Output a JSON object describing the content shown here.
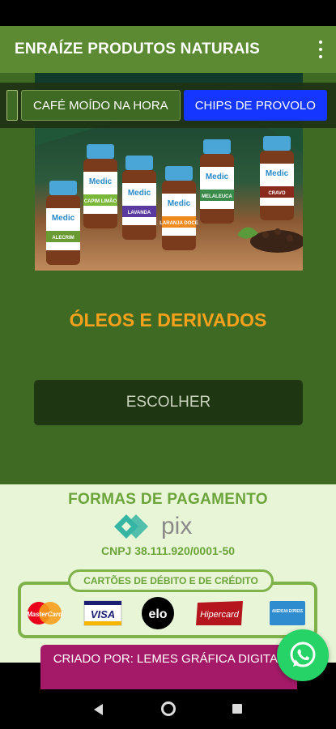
{
  "app": {
    "title": "ENRAÍZE PRODUTOS NATURAIS"
  },
  "tabs": [
    {
      "label": "CAFÉ MOÍDO NA HORA",
      "active": false
    },
    {
      "label": "CHIPS DE PROVOLO",
      "active": true
    }
  ],
  "banner": {
    "brand": "Medic",
    "products": [
      "ALECRIM",
      "CAPIM LIMÃO",
      "LAVANDA",
      "LARANJA DOCE",
      "MELALEUCA",
      "CRAVO"
    ]
  },
  "section": {
    "title": "ÓLEOS E DERIVADOS",
    "button_label": "ESCOLHER"
  },
  "payment": {
    "title": "FORMAS DE PAGAMENTO",
    "pix_label": "pix",
    "cnpj": "CNPJ 38.111.920/0001-50",
    "cards_title": "CARTÕES DE DÉBITO E DE CRÉDITO",
    "cards": [
      "MasterCard",
      "VISA",
      "elo",
      "Hipercard",
      "AMERICAN EXPRESS"
    ]
  },
  "footer": {
    "credit": "CRIADO POR: LEMES GRÁFICA DIGITAL"
  },
  "colors": {
    "appbar": "#5b8a32",
    "background": "#3f6a23",
    "accent_orange": "#f5a11c",
    "active_tab": "#1536ff",
    "payment_green": "#6ba43a",
    "credit_bar": "#a41a68",
    "whatsapp": "#25d366"
  },
  "icons": [
    "more-vert-icon",
    "pix-icon",
    "whatsapp-icon",
    "back-icon",
    "home-icon",
    "recents-icon"
  ]
}
